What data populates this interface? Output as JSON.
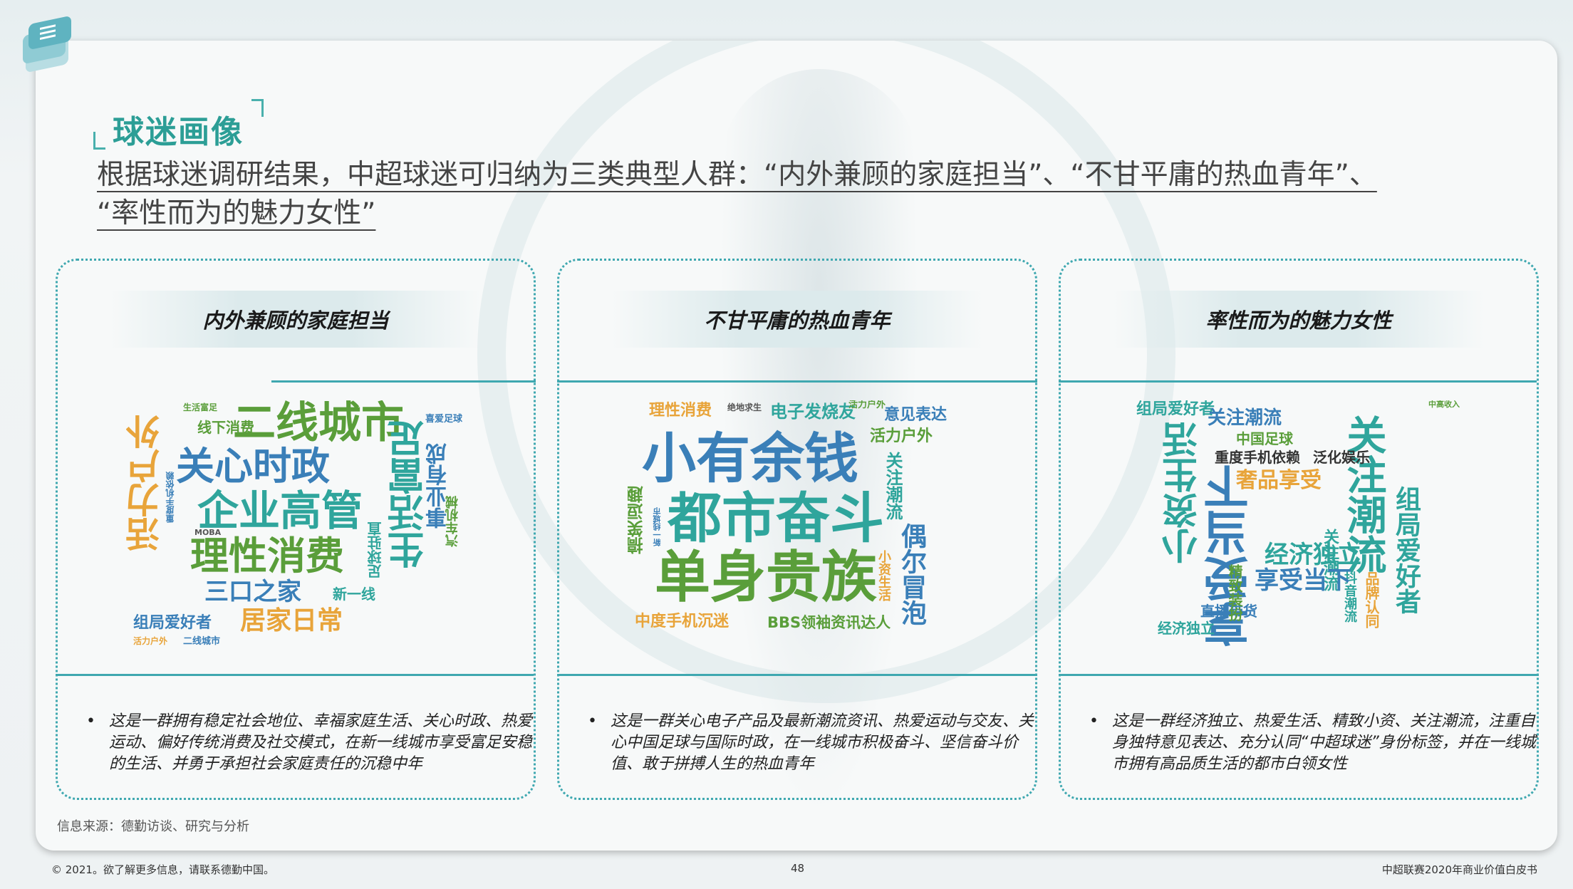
{
  "section_title": "球迷画像",
  "subtitle": {
    "line1": "根据球迷调研结果，中超球迷可归纳为三类典型人群：“内外兼顾的家庭担当”、“不甘平庸的热血青年”、",
    "line2": "“率性而为的魅力女性”"
  },
  "colors": {
    "teal": "#2c9e96",
    "panel_border": "#3fa8b0",
    "orange": "#e8a43a",
    "green": "#5a9e3a",
    "blue": "#3a7fb8",
    "tealword": "#2fa59c"
  },
  "panels": [
    {
      "title": "内外兼顾的家庭担当",
      "desc": "这是一群拥有稳定社会地位、幸福家庭生活、关心时政、热爱运动、偏好传统消费及社交模式，在新一线城市享受富足安稳的生活、并勇于承担社会家庭责任的沉稳中年",
      "words": [
        "二线城市",
        "关心时政",
        "企业高管",
        "理性消费",
        "活力户外",
        "生活富足",
        "事业有成",
        "三口之家",
        "居家日常",
        "组局爱好者",
        "新一线",
        "汽车机械",
        "足球驻直",
        "线下消费",
        "生活富足",
        "喜爱足球",
        "重度手机依赖",
        "活力户外",
        "二线城市",
        "MOBA"
      ]
    },
    {
      "title": "不甘平庸的热血青年",
      "desc": "这是一群关心电子产品及最新潮流资讯、热爱运动与交友、关心中国足球与国际时政，在一线城市积极奋斗、坚信奋斗价值、敢于拼搏人生的热血青年",
      "words": [
        "小有余钱",
        "都市奋斗",
        "单身贵族",
        "偶尔冒泡",
        "理性消费",
        "电子发烧友",
        "意见表达",
        "活力户外",
        "关注潮流",
        "搞笑逗趣",
        "中度手机沉迷",
        "BBS领袖资讯达人",
        "小资生活",
        "绝地求生",
        "活力户外",
        "新一线城市"
      ]
    },
    {
      "title": "率性而为的魅力女性",
      "desc": "这是一群经济独立、热爱生活、精致小资、关注潮流，注重自身独特意见表达、充分认同“中超球迷”身份标签，并在一线城市拥有高品质生活的都市白领女性",
      "words": [
        "享受当下",
        "关注潮流",
        "小资生活",
        "经济独立",
        "组局爱好者",
        "奢品享受",
        "中国足球",
        "重度手机依赖",
        "泛化娱乐",
        "品牌认同",
        "直播带货",
        "精致装扮",
        "抖音潮流",
        "组局爱好者",
        "经济独立",
        "关注潮流",
        "中高收入"
      ]
    }
  ],
  "source": "信息来源：德勤访谈、研究与分析",
  "footer": {
    "left": "© 2021。欲了解更多信息，请联系德勤中国。",
    "page": "48",
    "right": "中超联赛2020年商业价值白皮书"
  }
}
